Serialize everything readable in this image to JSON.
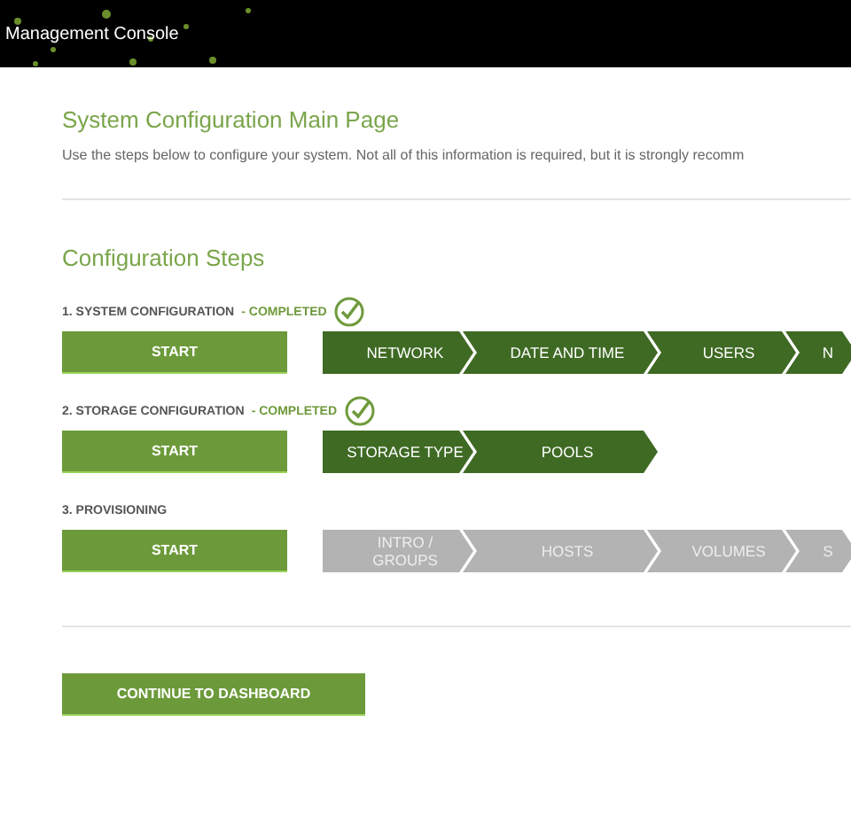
{
  "header": {
    "title": "Management Console"
  },
  "page": {
    "title": "System Configuration Main Page",
    "description": "Use the steps below to configure your system. Not all of this information is required, but it is strongly recomm"
  },
  "section_title": "Configuration Steps",
  "steps": [
    {
      "label": "1. SYSTEM CONFIGURATION",
      "status": "- COMPLETED",
      "completed": true,
      "start": "START",
      "substeps": [
        "NETWORK",
        "DATE AND TIME",
        "USERS",
        "N"
      ]
    },
    {
      "label": "2. STORAGE CONFIGURATION",
      "status": "- COMPLETED",
      "completed": true,
      "start": "START",
      "substeps": [
        "STORAGE TYPE",
        "POOLS"
      ]
    },
    {
      "label": "3. PROVISIONING",
      "completed": false,
      "start": "START",
      "substeps": [
        "INTRO / GROUPS",
        "HOSTS",
        "VOLUMES",
        "S"
      ]
    }
  ],
  "continue_button": "CONTINUE TO DASHBOARD"
}
